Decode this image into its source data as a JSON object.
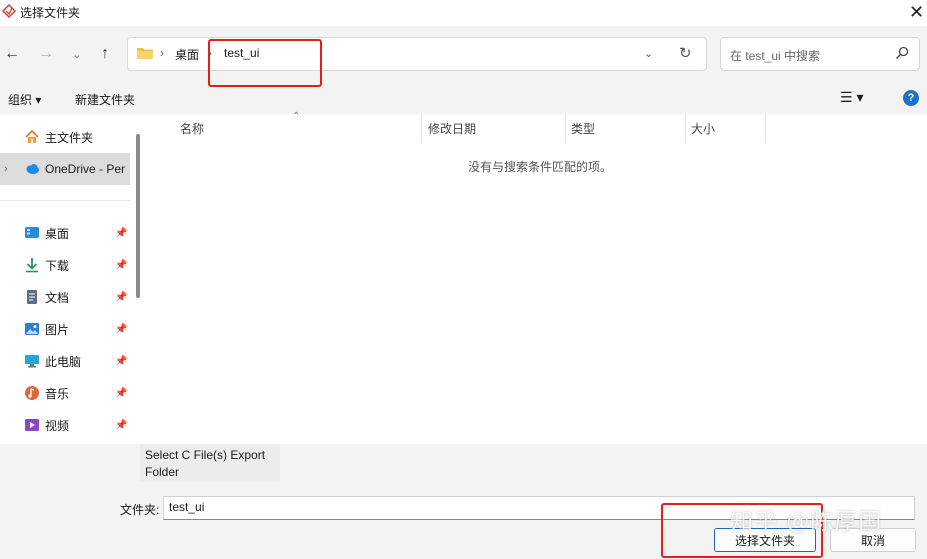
{
  "window": {
    "title": "选择文件夹",
    "close": "✕"
  },
  "nav": {
    "back": "←",
    "forward": "→",
    "recent": "⌄",
    "up": "↑",
    "breadcrumb": [
      "桌面",
      "test_ui"
    ],
    "sep": "›",
    "address_dropdown": "⌄",
    "refresh": "↻",
    "search_placeholder": "在 test_ui 中搜索"
  },
  "toolbar": {
    "organize": "组织 ▾",
    "new_folder": "新建文件夹",
    "view": "☰ ▾",
    "help": "?"
  },
  "sidebar": {
    "home": "主文件夹",
    "onedrive": "OneDrive - Per",
    "chevron": "›",
    "pin": "📌",
    "items": [
      {
        "label": "桌面",
        "icon": "desktop-icon"
      },
      {
        "label": "下载",
        "icon": "download-icon"
      },
      {
        "label": "文档",
        "icon": "documents-icon"
      },
      {
        "label": "图片",
        "icon": "pictures-icon"
      },
      {
        "label": "此电脑",
        "icon": "computer-icon"
      },
      {
        "label": "音乐",
        "icon": "music-icon"
      },
      {
        "label": "视频",
        "icon": "videos-icon"
      }
    ]
  },
  "list": {
    "columns": [
      "名称",
      "修改日期",
      "类型",
      "大小"
    ],
    "sort_arrow": "⌃",
    "empty_message": "没有与搜索条件匹配的项。"
  },
  "hint": "Select C File(s) Export Folder",
  "footer": {
    "folder_label": "文件夹:",
    "folder_value": "test_ui",
    "select_button": "选择文件夹",
    "cancel_button": "取消"
  },
  "watermark": "知乎 @陈厚国",
  "colors": {
    "accent": "#1a73c8",
    "annotation": "#e3201a",
    "chrome": "#f3f3f3",
    "folder": "#f0c040"
  }
}
